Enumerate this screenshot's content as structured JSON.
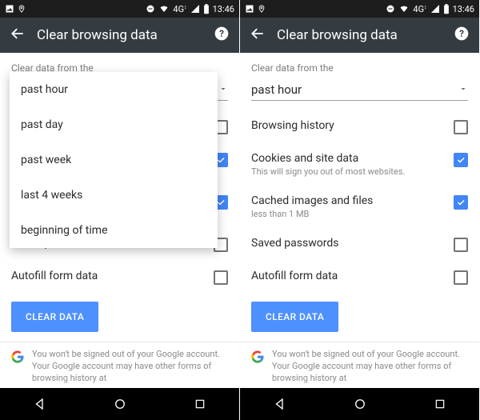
{
  "status": {
    "net_text": "4G",
    "time": "13:46"
  },
  "appbar": {
    "title": "Clear browsing data"
  },
  "section": {
    "label": "Clear data from the",
    "dropdown_value": "past hour"
  },
  "options": [
    {
      "label": "Browsing history",
      "sub": "",
      "checked": false
    },
    {
      "label": "Cookies and site data",
      "sub": "This will sign you out of most websites.",
      "checked": true
    },
    {
      "label": "Cached images and files",
      "sub": "less than 1 MB",
      "checked": true
    },
    {
      "label": "Saved passwords",
      "sub": "",
      "checked": false
    },
    {
      "label": "Autofill form data",
      "sub": "",
      "checked": false
    }
  ],
  "dropdown_items": [
    "past hour",
    "past day",
    "past week",
    "last 4 weeks",
    "beginning of time"
  ],
  "clear_button": "CLEAR DATA",
  "note": "You won't be signed out of your Google account. Your Google account may have other forms of browsing history at"
}
